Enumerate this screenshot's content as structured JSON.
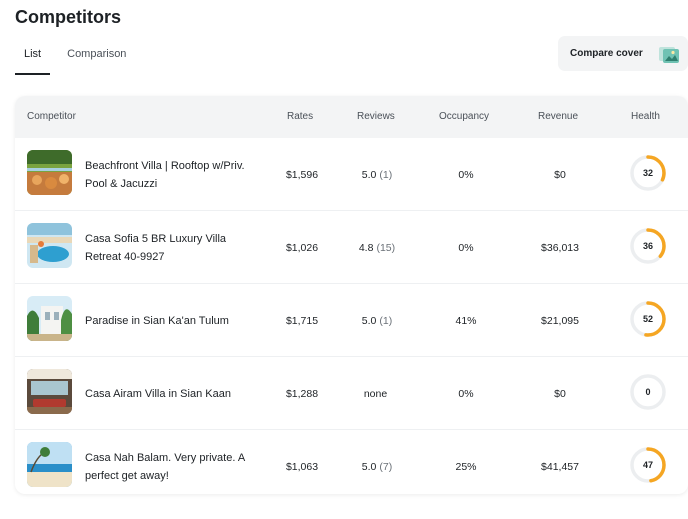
{
  "page": {
    "title": "Competitors"
  },
  "tabs": [
    {
      "label": "List",
      "active": true
    },
    {
      "label": "Comparison",
      "active": false
    }
  ],
  "compare_button": {
    "label": "Compare cover",
    "icon": "cover-image-icon"
  },
  "table": {
    "headers": {
      "competitor": "Competitor",
      "rates": "Rates",
      "reviews": "Reviews",
      "occupancy": "Occupancy",
      "revenue": "Revenue",
      "health": "Health"
    },
    "rows": [
      {
        "name": "Beachfront Villa | Rooftop w/Priv. Pool & Jacuzzi",
        "rate": "$1,596",
        "reviews_score": "5.0",
        "reviews_count": "(1)",
        "occupancy": "0%",
        "revenue": "$0",
        "health": 32
      },
      {
        "name": "Casa Sofia 5 BR Luxury Villa Retreat 40-9927",
        "rate": "$1,026",
        "reviews_score": "4.8",
        "reviews_count": "(15)",
        "occupancy": "0%",
        "revenue": "$36,013",
        "health": 36
      },
      {
        "name": "Paradise in Sian Ka'an Tulum",
        "rate": "$1,715",
        "reviews_score": "5.0",
        "reviews_count": "(1)",
        "occupancy": "41%",
        "revenue": "$21,095",
        "health": 52
      },
      {
        "name": "Casa Airam Villa in Sian Kaan",
        "rate": "$1,288",
        "reviews_score": "none",
        "reviews_count": "",
        "occupancy": "0%",
        "revenue": "$0",
        "health": 0
      },
      {
        "name": "Casa Nah Balam. Very private. A perfect get away!",
        "rate": "$1,063",
        "reviews_score": "5.0",
        "reviews_count": "(7)",
        "occupancy": "25%",
        "revenue": "$41,457",
        "health": 47
      }
    ]
  },
  "colors": {
    "health_ring": "#f5a623",
    "health_track": "#eceef0",
    "header_bg": "#f3f4f5"
  }
}
